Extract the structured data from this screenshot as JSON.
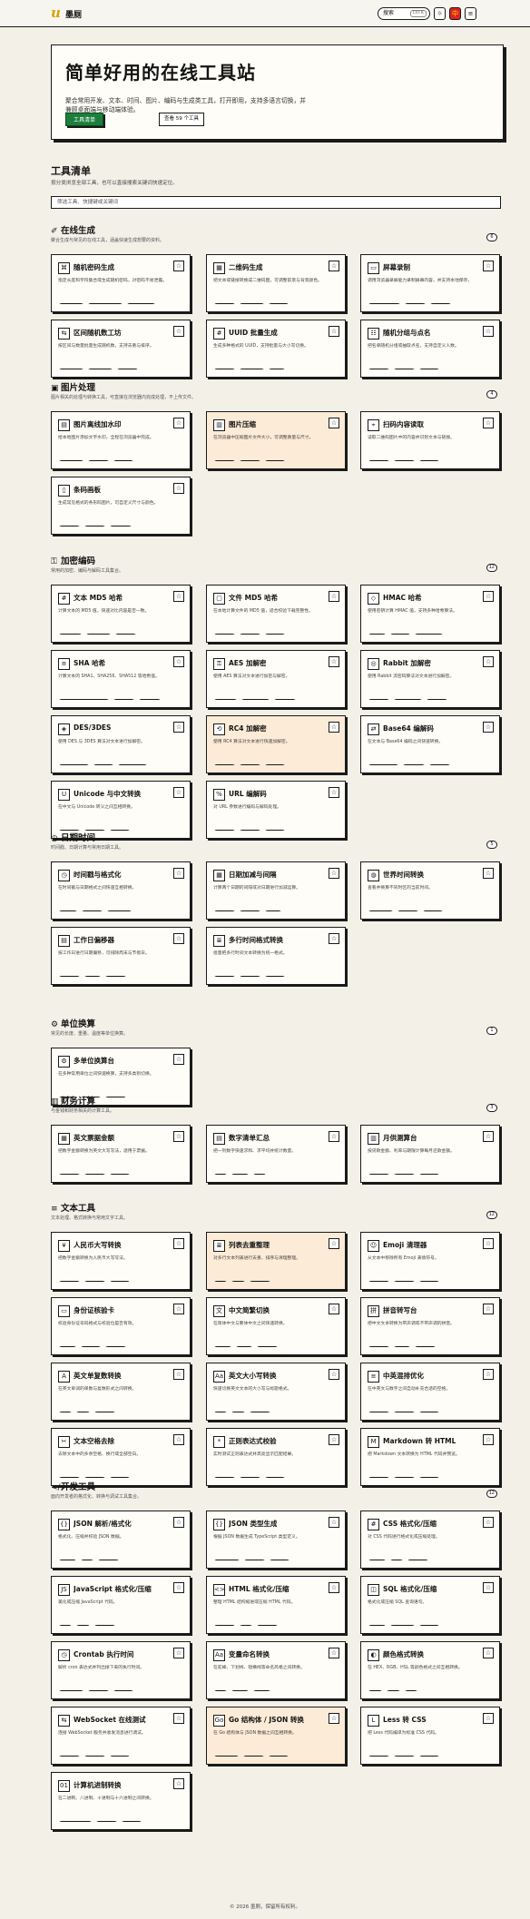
{
  "header": {
    "brand": "墨厕",
    "search_label": "搜索",
    "search_kbd": "Ctrl K",
    "theme_icon": "sun-icon",
    "lang": "中",
    "menu_icon": "menu-icon"
  },
  "hero": {
    "title": "简单好用的在线工具站",
    "desc": "聚合常用开发、文本、时间、图片、编码与生成类工具，打开即用，支持多语言切换，并兼顾桌面端与移动端体验。",
    "primary_btn": "工具清单",
    "secondary_btn": "查看 59 个工具"
  },
  "list": {
    "title": "工具清单",
    "subtitle": "按分类浏览全部工具，也可以直接搜索关键词快速定位。",
    "filter_placeholder": "筛选工具、快捷键或关键词"
  },
  "sections": [
    {
      "name": "在线生成",
      "icon": "✐",
      "desc": "聚合生成与常见的在线工具，涵盖快速生成想要的资料。",
      "count": "6",
      "cards": [
        {
          "title": "随机密码生成",
          "icon": "⌘",
          "desc": "指定长度和字符集合或生成随机密码，对密码不易泄露。",
          "tags": [
            "自定义长度",
            "大小写/数字/符号",
            "多种格式选择"
          ],
          "hl": false
        },
        {
          "title": "二维码生成",
          "icon": "▦",
          "desc": "把文本或链接转换成二维码图，可调整前景与背景颜色。",
          "tags": [
            "尺寸控制",
            "颜色自定义",
            "图片下载"
          ],
          "hl": false
        },
        {
          "title": "屏幕录制",
          "icon": "▭",
          "desc": "调用浏览器录屏能力录制屏幕内容，并支持本地保存。",
          "tags": [
            "浏览器原生录制",
            "音频控制",
            "本地下载"
          ],
          "hl": false
        },
        {
          "title": "区间随机数工坊",
          "icon": "⇆",
          "desc": "按区间与数量批量生成随机数，支持去重与排序。",
          "tags": [
            "去除与排序",
            "唯一化处理",
            "多结果集"
          ],
          "hl": false
        },
        {
          "title": "UUID 批量生成",
          "icon": "#",
          "desc": "生成多种格式的 UUID，支持批量与大小写切换。",
          "tags": [
            "批量生成",
            "大小写切换",
            "多格式"
          ],
          "hl": false
        },
        {
          "title": "随机分组与点名",
          "icon": "☷",
          "desc": "把名单随机分组或抽取点名，支持自定义人数。",
          "tags": [
            "随机分组",
            "课堂点名",
            "结果导出"
          ],
          "hl": false
        }
      ]
    },
    {
      "name": "图片处理",
      "icon": "▣",
      "desc": "图片相关的处理与转换工具，可直接在浏览器内完成处理，不上传文件。",
      "count": "4",
      "cards": [
        {
          "title": "图片离线加水印",
          "icon": "▤",
          "desc": "给本地图片添加文字水印，全程在浏览器中完成。",
          "tags": [
            "多字体排版",
            "批量处理",
            "导出格式"
          ],
          "hl": false
        },
        {
          "title": "图片压缩",
          "icon": "▥",
          "desc": "在浏览器中压缩图片文件大小，可调整质量与尺寸。",
          "tags": [
            "质量调节",
            "尺寸限制",
            "批量下载"
          ],
          "hl": true
        },
        {
          "title": "扫码内容读取",
          "icon": "⌖",
          "desc": "读取二维码图片中的内容并识别文本与链接。",
          "tags": [
            "本地识别",
            "批量读取",
            "结果复制"
          ],
          "hl": false
        },
        {
          "title": "条码画板",
          "icon": "▯",
          "desc": "生成常见格式的条形码图片，可自定义尺寸与颜色。",
          "tags": [
            "多种格式",
            "尺寸调节",
            "SVG 下载"
          ],
          "hl": false
        }
      ]
    },
    {
      "name": "加密编码",
      "icon": "⚿",
      "desc": "常用的加密、编码与解码工具集合。",
      "count": "12",
      "cards": [
        {
          "title": "文本 MD5 哈希",
          "icon": "#",
          "desc": "计算文本的 MD5 值，快速对比内容是否一致。",
          "tags": [
            "32 位输出",
            "大小写切换",
            "一键复制"
          ],
          "hl": false
        },
        {
          "title": "文件 MD5 哈希",
          "icon": "▢",
          "desc": "在本地计算文件的 MD5 值，适合校验下载完整性。",
          "tags": [
            "本地计算",
            "拖拽上传",
            "进度显示"
          ],
          "hl": false
        },
        {
          "title": "HMAC 哈希",
          "icon": "◇",
          "desc": "使用密钥计算 HMAC 值，支持多种哈希算法。",
          "tags": [
            "多算法",
            "密钥输入",
            "十六进制输出"
          ],
          "hl": false
        },
        {
          "title": "SHA 哈希",
          "icon": "≡",
          "desc": "计算文本的 SHA1、SHA256、SHA512 等哈希值。",
          "tags": [
            "SHA1/224/256/384/512",
            "实时计算",
            "Hex 输出"
          ],
          "hl": false
        },
        {
          "title": "AES 加解密",
          "icon": "⚿",
          "desc": "使用 AES 算法对文本进行加密与解密。",
          "tags": [
            "CBC/ECB",
            "Hex/Base64",
            "自定义 IV"
          ],
          "hl": false
        },
        {
          "title": "Rabbit 加解密",
          "icon": "◎",
          "desc": "使用 Rabbit 流密码算法对文本进行加解密。",
          "tags": [
            "密钥输入",
            "Base64 输出",
            "一键复制"
          ],
          "hl": false
        },
        {
          "title": "DES/3DES",
          "icon": "◈",
          "desc": "使用 DES 与 3DES 算法对文本进行加解密。",
          "tags": [
            "DES 与 3DES",
            "多种模式",
            "Base64 输出"
          ],
          "hl": false
        },
        {
          "title": "RC4 加解密",
          "icon": "⟲",
          "desc": "使用 RC4 算法对文本进行快速加解密。",
          "tags": [
            "快速处理",
            "编码选择",
            "一键复制"
          ],
          "hl": true
        },
        {
          "title": "Base64 编解码",
          "icon": "⇄",
          "desc": "在文本与 Base64 编码之间快速转换。",
          "tags": [
            "Unicode 支持",
            "编码/解码",
            "一键复制"
          ],
          "hl": false
        },
        {
          "title": "Unicode 与中文转换",
          "icon": "U",
          "desc": "在中文与 Unicode 转义之间互相转换。",
          "tags": [
            "双向转换",
            "批量处理",
            "结果复制"
          ],
          "hl": false
        },
        {
          "title": "URL 编解码",
          "icon": "%",
          "desc": "对 URL 参数进行编码与解码处理。",
          "tags": [
            "组件编码",
            "整体编码",
            "一键复制"
          ],
          "hl": false
        }
      ]
    },
    {
      "name": "日期时间",
      "icon": "◷",
      "desc": "时间戳、日期计算与常用日期工具。",
      "count": "5",
      "cards": [
        {
          "title": "时间戳与格式化",
          "icon": "◷",
          "desc": "在时间戳与日期格式之间快速互相转换。",
          "tags": [
            "秒/毫秒",
            "时区切换",
            "自定义格式"
          ],
          "hl": false
        },
        {
          "title": "日期加减与间隔",
          "icon": "▦",
          "desc": "计算两个日期的间隔或对日期进行加减运算。",
          "tags": [
            "天数计算",
            "加减日期",
            "工作日"
          ],
          "hl": false
        },
        {
          "title": "世界时间转换",
          "icon": "◍",
          "desc": "查看并换算不同时区的当前时间。",
          "tags": [
            "多城市对照",
            "一键切换",
            "时区选择"
          ],
          "hl": false
        },
        {
          "title": "工作日偏移器",
          "icon": "▤",
          "desc": "按工作日进行日期偏移，可排除周末与节假日。",
          "tags": [
            "排除周末",
            "节假日",
            "结果列表"
          ],
          "hl": false
        },
        {
          "title": "多行时间格式转换",
          "icon": "≣",
          "desc": "批量把多行时间文本转换为统一格式。",
          "tags": [
            "批量转换",
            "多种格式",
            "结果复制"
          ],
          "hl": false
        }
      ]
    },
    {
      "name": "单位换算",
      "icon": "⚙",
      "desc": "常见的长度、重量、温度等单位换算。",
      "count": "1",
      "cards": [
        {
          "title": "多单位换算台",
          "icon": "⚙",
          "desc": "在多种常用单位之间快速换算，支持多类别切换。",
          "tags": [
            "多类别",
            "实时换算",
            "常用单位"
          ],
          "hl": false
        }
      ]
    },
    {
      "name": "财务计算",
      "icon": "▥",
      "desc": "与金钱和财务相关的计算工具。",
      "count": "3",
      "cards": [
        {
          "title": "英文票据金额",
          "icon": "▦",
          "desc": "把数字金额转换为英文大写写法，适用于票据。",
          "tags": [
            "英文大写",
            "票据格式",
            "一键复制"
          ],
          "hl": false
        },
        {
          "title": "数字清单汇总",
          "icon": "▤",
          "desc": "把一列数字快速求和、求平均并统计数量。",
          "tags": [
            "求和",
            "平均值",
            "统计"
          ],
          "hl": false
        },
        {
          "title": "月供测算台",
          "icon": "▥",
          "desc": "按贷款金额、利率与期限计算每月还款金额。",
          "tags": [
            "等额本息",
            "等额本金",
            "还款明细"
          ],
          "hl": false
        }
      ]
    },
    {
      "name": "文本工具",
      "icon": "≡",
      "desc": "文本处理、格式转换与常用文字工具。",
      "count": "12",
      "cards": [
        {
          "title": "人民币大写转换",
          "icon": "¥",
          "desc": "把数字金额转换为人民币大写写法。",
          "tags": [
            "金额校验",
            "一键复制",
            "票据格式"
          ],
          "hl": false
        },
        {
          "title": "列表去重整理",
          "icon": "≣",
          "desc": "对多行文本列表进行去重、排序与清理整理。",
          "tags": [
            "去重",
            "排序",
            "空行清理"
          ],
          "hl": true
        },
        {
          "title": "Emoji 清理器",
          "icon": "☺",
          "desc": "从文本中移除所有 Emoji 表情符号。",
          "tags": [
            "批量清理",
            "保留文本",
            "结果复制"
          ],
          "hl": false
        },
        {
          "title": "身份证核验卡",
          "icon": "▭",
          "desc": "校验身份证号码格式与校验位是否有效。",
          "tags": [
            "校验位",
            "地区解析",
            "出生日期"
          ],
          "hl": false
        },
        {
          "title": "中文简繁切换",
          "icon": "文",
          "desc": "在简体中文与繁体中文之间快速转换。",
          "tags": [
            "简转繁",
            "繁转简",
            "一键复制"
          ],
          "hl": false
        },
        {
          "title": "拼音转写台",
          "icon": "拼",
          "desc": "把中文文本转换为带声调或不带声调的拼音。",
          "tags": [
            "声调切换",
            "首字母",
            "结果复制"
          ],
          "hl": false
        },
        {
          "title": "英文单复数转换",
          "icon": "A",
          "desc": "在英文单词的单数与复数形式之间转换。",
          "tags": [
            "单数",
            "复数",
            "批量处理"
          ],
          "hl": false
        },
        {
          "title": "英文大小写转换",
          "icon": "Aa",
          "desc": "快速切换英文文本的大小写与标题格式。",
          "tags": [
            "大写",
            "小写",
            "标题格式"
          ],
          "hl": false
        },
        {
          "title": "中英混排优化",
          "icon": "≡",
          "desc": "在中英文与数字之间自动补充合适的空格。",
          "tags": [
            "自动空格",
            "标点修正",
            "一键复制"
          ],
          "hl": false
        },
        {
          "title": "文本空格去除",
          "icon": "✂",
          "desc": "去除文本中的多余空格、换行或全部空白。",
          "tags": [
            "首尾空格",
            "多余换行",
            "全部空白"
          ],
          "hl": false
        },
        {
          "title": "正则表达式校验",
          "icon": "*",
          "desc": "实时测试正则表达式并高亮显示匹配结果。",
          "tags": [
            "实时匹配",
            "高亮显示",
            "常用模板"
          ],
          "hl": false
        },
        {
          "title": "Markdown 转 HTML",
          "icon": "M",
          "desc": "把 Markdown 文本转换为 HTML 代码并预览。",
          "tags": [
            "实时预览",
            "代码复制",
            "语法支持"
          ],
          "hl": false
        }
      ]
    },
    {
      "name": "开发工具",
      "icon": "</>",
      "desc": "面向开发者的格式化、转换与调试工具集合。",
      "count": "12",
      "cards": [
        {
          "title": "JSON 解析/格式化",
          "icon": "{}",
          "desc": "格式化、压缩并校验 JSON 数据。",
          "tags": [
            "格式化",
            "压缩",
            "语法校验"
          ],
          "hl": false
        },
        {
          "title": "JSON 类型生成",
          "icon": "{}",
          "desc": "根据 JSON 数据生成 TypeScript 类型定义。",
          "tags": [
            "TypeScript",
            "嵌套类型",
            "一键复制"
          ],
          "hl": false
        },
        {
          "title": "CSS 格式化/压缩",
          "icon": "#",
          "desc": "对 CSS 代码进行格式化或压缩处理。",
          "tags": [
            "格式化",
            "压缩",
            "一键复制"
          ],
          "hl": false
        },
        {
          "title": "JavaScript 格式化/压缩",
          "icon": "JS",
          "desc": "美化或压缩 JavaScript 代码。",
          "tags": [
            "美化",
            "压缩",
            "一键复制"
          ],
          "hl": false
        },
        {
          "title": "HTML 格式化/压缩",
          "icon": "<>",
          "desc": "整理 HTML 结构缩进或压缩 HTML 代码。",
          "tags": [
            "缩进整理",
            "压缩",
            "一键复制"
          ],
          "hl": false
        },
        {
          "title": "SQL 格式化/压缩",
          "icon": "◫",
          "desc": "格式化或压缩 SQL 查询语句。",
          "tags": [
            "多方言",
            "关键字大写",
            "一键复制"
          ],
          "hl": false
        },
        {
          "title": "Crontab 执行时间",
          "icon": "◷",
          "desc": "解析 cron 表达式并列出接下来的执行时间。",
          "tags": [
            "表达式解析",
            "执行预览",
            "常用模板"
          ],
          "hl": false
        },
        {
          "title": "变量命名转换",
          "icon": "Aa",
          "desc": "在驼峰、下划线、短横线等命名风格之间转换。",
          "tags": [
            "驼峰",
            "下划线",
            "短横线"
          ],
          "hl": false
        },
        {
          "title": "颜色格式转换",
          "icon": "◐",
          "desc": "在 HEX、RGB、HSL 等颜色格式之间互相转换。",
          "tags": [
            "HEX",
            "RGB",
            "HSL"
          ],
          "hl": false
        },
        {
          "title": "WebSocket 在线测试",
          "icon": "⇆",
          "desc": "连接 WebSocket 服务并收发消息进行调试。",
          "tags": [
            "实时连接",
            "消息收发",
            "日志记录"
          ],
          "hl": false
        },
        {
          "title": "Go 结构体 / JSON 转换",
          "icon": "Go",
          "desc": "在 Go 结构体与 JSON 数据之间互相转换。",
          "tags": [
            "结构体生成",
            "标签配置",
            "一键复制"
          ],
          "hl": true
        },
        {
          "title": "Less 转 CSS",
          "icon": "L",
          "desc": "把 Less 代码编译为标准 CSS 代码。",
          "tags": [
            "在线编译",
            "错误提示",
            "一键复制"
          ],
          "hl": false
        },
        {
          "title": "计算机进制转换",
          "icon": "01",
          "desc": "在二进制、八进制、十进制与十六进制之间转换。",
          "tags": [
            "2/8/10/16 进制",
            "实时转换",
            "一键复制"
          ],
          "hl": false
        }
      ]
    }
  ],
  "footer": "© 2026 墨厕，保留所有权利。"
}
